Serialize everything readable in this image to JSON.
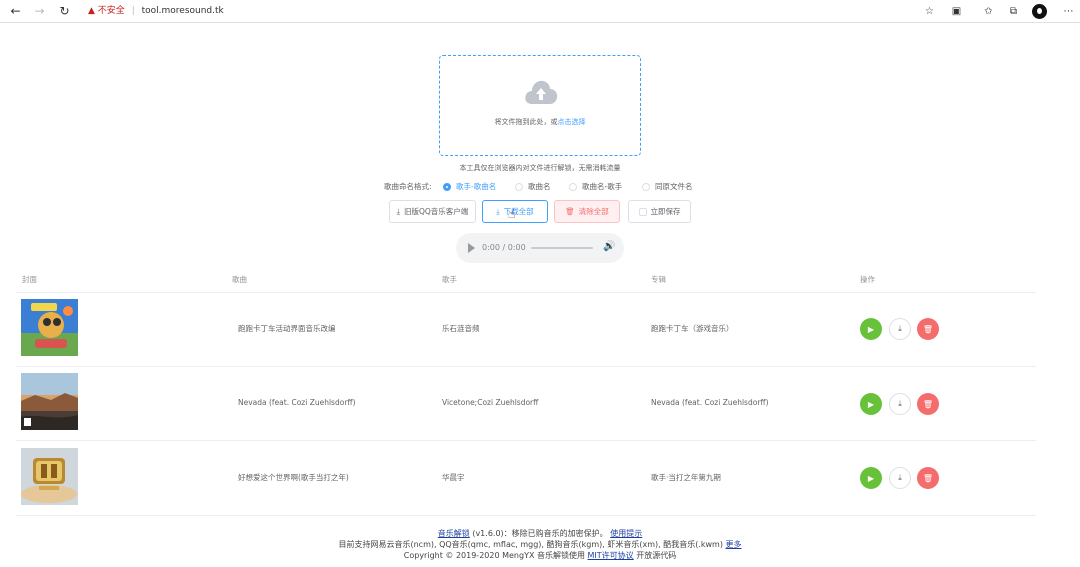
{
  "browser": {
    "security_label": "不安全",
    "url": "tool.moresound.tk"
  },
  "upload": {
    "text_prefix": "将文件拖到此处，或",
    "link": "点击选择",
    "tip": "本工具仅在浏览器内对文件进行解锁，无需消耗流量"
  },
  "naming": {
    "label": "歌曲命名格式:",
    "options": [
      "歌手-歌曲名",
      "歌曲名",
      "歌曲名-歌手",
      "同原文件名"
    ],
    "selected": "歌手-歌曲名"
  },
  "actions": {
    "legacy_qq": "旧版QQ音乐客户端",
    "download_all": "下载全部",
    "clear_all": "清除全部",
    "save_now": "立即保存"
  },
  "player": {
    "time": "0:00 / 0:00"
  },
  "table": {
    "headers": [
      "封面",
      "歌曲",
      "歌手",
      "专辑",
      "操作"
    ],
    "rows": [
      {
        "song": "跑跑卡丁车活动界面音乐改编",
        "artist": "乐石涟音频",
        "album": "跑跑卡丁车（游戏音乐）"
      },
      {
        "song": "Nevada (feat. Cozi Zuehlsdorff)",
        "artist": "Vicetone;Cozi Zuehlsdorff",
        "album": "Nevada (feat. Cozi Zuehlsdorff)"
      },
      {
        "song": "好想爱这个世界啊(歌手当打之年)",
        "artist": "华晨宇",
        "album": "歌手·当打之年第九期"
      }
    ]
  },
  "footer": {
    "app_link": "音乐解锁",
    "version_text": "(v1.6.0)：移除已购音乐的加密保护。",
    "tips_link": "使用提示",
    "formats_text": "目前支持网易云音乐(ncm), QQ音乐(qmc, mflac, mgg), 酷狗音乐(kgm), 虾米音乐(xm), 酷我音乐(.kwm)",
    "more_link": "更多",
    "copyright": "Copyright © 2019-2020 MengYX 音乐解锁使用",
    "license_link": "MIT许可协议",
    "license_suffix": "开放源代码"
  },
  "colors": {
    "primary": "#409eff",
    "success": "#67c23a",
    "danger": "#f56c6c"
  }
}
